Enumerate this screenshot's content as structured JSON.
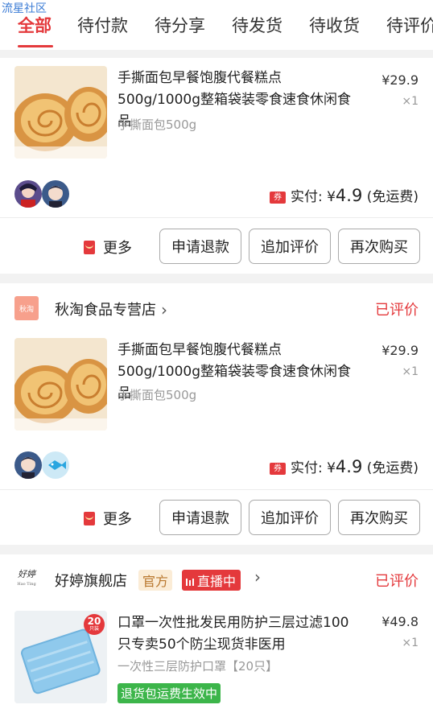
{
  "watermark": "流星社区",
  "tabs": [
    {
      "label": "全部",
      "active": true
    },
    {
      "label": "待付款"
    },
    {
      "label": "待分享"
    },
    {
      "label": "待发货"
    },
    {
      "label": "待收货"
    },
    {
      "label": "待评价"
    }
  ],
  "orders": [
    {
      "product": {
        "title": "手撕面包早餐饱腹代餐糕点500g/1000g整箱袋装零食速食休闲食品",
        "spec": "手撕面包500g",
        "price": "¥29.9",
        "qty": "×1"
      },
      "payment": {
        "coupon_icon": "券",
        "label": "实付:",
        "currency": "¥",
        "amount": "4.9",
        "note": "(免运费)"
      },
      "actions": {
        "more": "更多",
        "refund": "申请退款",
        "review": "追加评价",
        "rebuy": "再次购买"
      }
    },
    {
      "shop": {
        "logo_text": "秋淘",
        "name": "秋淘食品专营店",
        "status": "已评价"
      },
      "product": {
        "title": "手撕面包早餐饱腹代餐糕点500g/1000g整箱袋装零食速食休闲食品",
        "spec": "手撕面包500g",
        "price": "¥29.9",
        "qty": "×1"
      },
      "payment": {
        "coupon_icon": "券",
        "label": "实付:",
        "currency": "¥",
        "amount": "4.9",
        "note": "(免运费)"
      },
      "actions": {
        "more": "更多",
        "refund": "申请退款",
        "review": "追加评价",
        "rebuy": "再次购买"
      }
    },
    {
      "shop": {
        "logo_text": "好婷",
        "logo_sub": "Hao Ting",
        "name": "好婷旗舰店",
        "official": "官方",
        "live": "直播中",
        "status": "已评价"
      },
      "product": {
        "title": "口罩一次性批发民用防护三层过滤100只专卖50个防尘现货非医用",
        "spec": "一次性三层防护口罩【20只】",
        "price": "¥49.8",
        "qty": "×1",
        "count_badge": "20",
        "count_badge_sub": "只装",
        "tag": "退货包运费生效中"
      }
    }
  ],
  "colors": {
    "accent": "#e4393c",
    "green": "#3cb54a"
  }
}
